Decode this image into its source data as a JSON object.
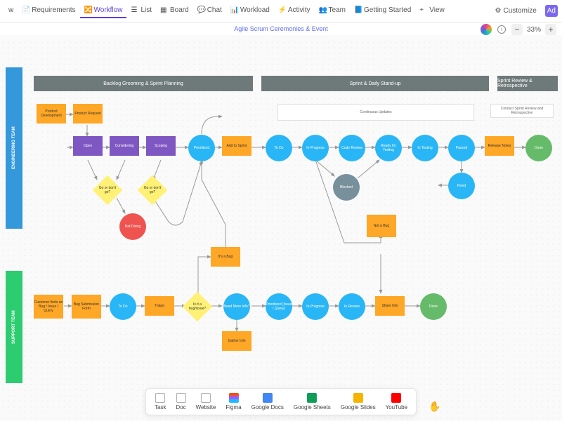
{
  "toolbar": {
    "tabs": [
      {
        "label": "w",
        "icon": ""
      },
      {
        "label": "Requirements",
        "icon": "doc"
      },
      {
        "label": "Workflow",
        "icon": "workflow",
        "active": true
      },
      {
        "label": "List",
        "icon": "list"
      },
      {
        "label": "Board",
        "icon": "board"
      },
      {
        "label": "Chat",
        "icon": "chat"
      },
      {
        "label": "Workload",
        "icon": "workload"
      },
      {
        "label": "Activity",
        "icon": "activity"
      },
      {
        "label": "Team",
        "icon": "team"
      },
      {
        "label": "Getting Started",
        "icon": "doc"
      },
      {
        "label": "View",
        "icon": "plus"
      }
    ],
    "customize": "Customize",
    "add": "Ad"
  },
  "title": "Agile Scrum Ceremonies & Event",
  "zoom": {
    "level": "33%",
    "minus": "−",
    "plus": "+"
  },
  "sections": {
    "s1": "Backlog Grooming & Sprint Planning",
    "s2": "Sprint & Daily Stand-up",
    "s3": "Sprint Review & Retrospective"
  },
  "lanes": {
    "l1": "ENGINEERING TEAM",
    "l2": "SUPPORT TEAM"
  },
  "nodes": {
    "prodDev": "Product Development",
    "prodReq": "Product Request",
    "open": "Open",
    "considering": "Considering",
    "scoping": "Scoping",
    "goNoGo1": "Go or don't go?",
    "goNoGo2": "Go or don't go?",
    "notDoing": "Not Doing",
    "prioritized": "Prioritized",
    "addSprint": "Add to Sprint",
    "contUpdates": "Continuous Updates",
    "todo1": "To Do",
    "inProgress1": "In Progress",
    "codeReview": "Code Review",
    "readyTesting": "Ready for Testing",
    "inTesting": "In Testing",
    "passed": "Passed",
    "blocked": "Blocked",
    "fixed": "Fixed",
    "releaseNotes": "Release Notes",
    "done1": "Done",
    "conductReview": "Conduct Sprint Review and Retrospective",
    "customerBug": "Customer finds an Bug / Issue / Query",
    "bugForm": "Bug Submission Form",
    "todo2": "To Do",
    "triage": "Triage",
    "isBug": "Is it a bug/issue?",
    "itsBug": "It's a Bug",
    "notBug": "Not a Bug",
    "needInfo": "Need More Info?",
    "priorIssue": "Prioritized (Issue / Query)",
    "inProgress2": "In Progress",
    "inReview": "In Review",
    "shareInfo": "Share Info",
    "gatherInfo": "Gather Info",
    "done2": "Done"
  },
  "bottomBar": {
    "items": [
      {
        "label": "Task",
        "color": "#fff",
        "border": "1px solid #aaa"
      },
      {
        "label": "Doc",
        "color": "#fff",
        "border": "1px solid #aaa"
      },
      {
        "label": "Website",
        "color": "#fff",
        "border": "1px solid #aaa"
      },
      {
        "label": "Figma",
        "color": "linear-gradient(180deg,#f24e1e 33%,#a259ff 33% 66%,#1abcfe 66%)"
      },
      {
        "label": "Google Docs",
        "color": "#4285f4"
      },
      {
        "label": "Google Sheets",
        "color": "#0f9d58"
      },
      {
        "label": "Google Slides",
        "color": "#f4b400"
      },
      {
        "label": "YouTube",
        "color": "#ff0000"
      }
    ]
  }
}
